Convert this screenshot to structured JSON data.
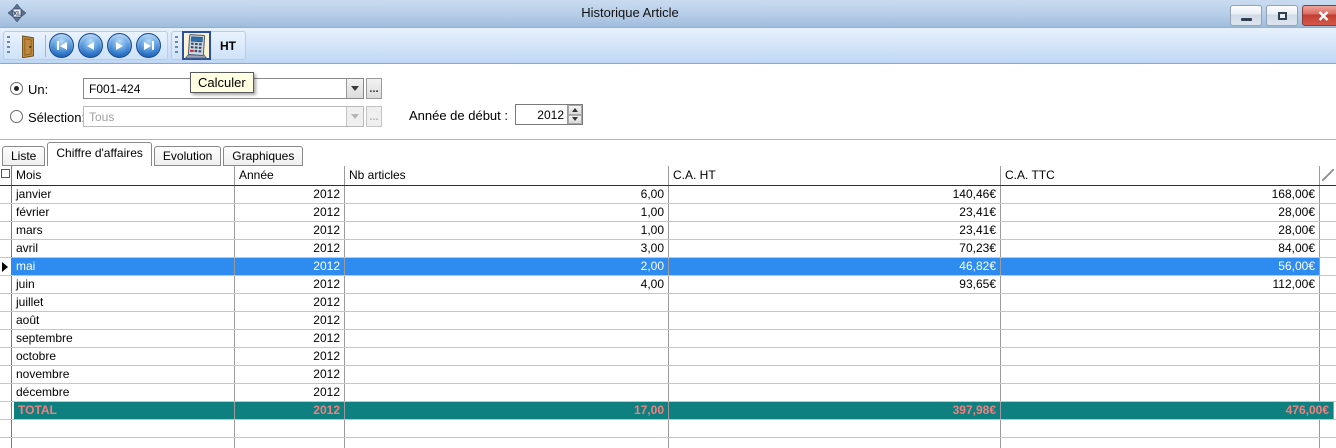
{
  "window": {
    "title": "Historique Article"
  },
  "titlebar": {
    "icons": {
      "app": "xl-move-cross",
      "minimize": "minimize-bar",
      "maximize": "restore-square",
      "close": "close-x"
    }
  },
  "toolbar": {
    "tooltip": "Calculer",
    "ht_label": "HT",
    "icons": {
      "exit": "door",
      "nav_first": "first-record",
      "nav_prev": "previous-record",
      "nav_next": "next-record",
      "nav_last": "last-record",
      "calculate": "calculator"
    }
  },
  "form": {
    "un": {
      "label": "Un:",
      "selected": true,
      "value": "F001-424"
    },
    "selection": {
      "label": "Sélection:",
      "selected": false,
      "value": "Tous"
    },
    "browse_label": "...",
    "year": {
      "label": "Année de début :",
      "value": "2012"
    }
  },
  "tabs": [
    {
      "label": "Liste",
      "active": false
    },
    {
      "label": "Chiffre d'affaires",
      "active": true
    },
    {
      "label": "Evolution",
      "active": false
    },
    {
      "label": "Graphiques",
      "active": false
    }
  ],
  "table": {
    "columns": [
      "Mois",
      "Année",
      "Nb articles",
      "C.A. HT",
      "C.A. TTC"
    ],
    "selected_index": 4,
    "rows": [
      {
        "mois": "janvier",
        "annee": "2012",
        "nb": "6,00",
        "ht": "140,46€",
        "ttc": "168,00€"
      },
      {
        "mois": "février",
        "annee": "2012",
        "nb": "1,00",
        "ht": "23,41€",
        "ttc": "28,00€"
      },
      {
        "mois": "mars",
        "annee": "2012",
        "nb": "1,00",
        "ht": "23,41€",
        "ttc": "28,00€"
      },
      {
        "mois": "avril",
        "annee": "2012",
        "nb": "3,00",
        "ht": "70,23€",
        "ttc": "84,00€"
      },
      {
        "mois": "mai",
        "annee": "2012",
        "nb": "2,00",
        "ht": "46,82€",
        "ttc": "56,00€"
      },
      {
        "mois": "juin",
        "annee": "2012",
        "nb": "4,00",
        "ht": "93,65€",
        "ttc": "112,00€"
      },
      {
        "mois": "juillet",
        "annee": "2012",
        "nb": "",
        "ht": "",
        "ttc": ""
      },
      {
        "mois": "août",
        "annee": "2012",
        "nb": "",
        "ht": "",
        "ttc": ""
      },
      {
        "mois": "septembre",
        "annee": "2012",
        "nb": "",
        "ht": "",
        "ttc": ""
      },
      {
        "mois": "octobre",
        "annee": "2012",
        "nb": "",
        "ht": "",
        "ttc": ""
      },
      {
        "mois": "novembre",
        "annee": "2012",
        "nb": "",
        "ht": "",
        "ttc": ""
      },
      {
        "mois": "décembre",
        "annee": "2012",
        "nb": "",
        "ht": "",
        "ttc": ""
      }
    ],
    "total": {
      "mois": "TOTAL",
      "annee": "2012",
      "nb": "17,00",
      "ht": "397,98€",
      "ttc": "476,00€"
    }
  },
  "colors": {
    "titlebar-top": "#c9dbf0",
    "titlebar-bottom": "#9fbcdd",
    "toolbar-top": "#e8f1fd",
    "toolbar-bottom": "#bed7f4",
    "selection": "#2e8cf0",
    "total-bg": "#0e8080",
    "total-text": "#f08080",
    "tooltip-bg": "#ffffe1",
    "close-red": "#c23c30",
    "grid-vline": "#9b9b9b",
    "grid-hline": "#c6c6c6"
  }
}
